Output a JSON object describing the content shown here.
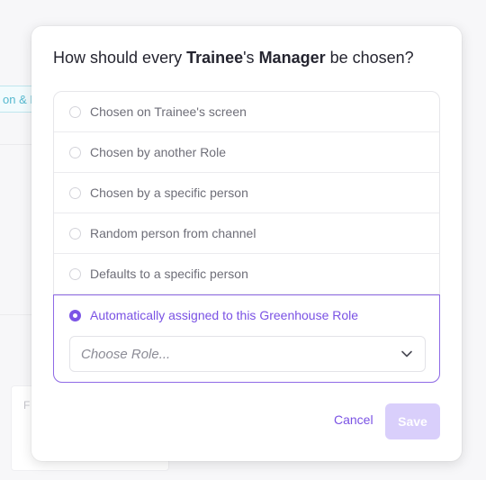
{
  "background": {
    "tag_text": "on & H",
    "card_letter": "F"
  },
  "dialog": {
    "title": {
      "prefix": "How should every ",
      "role_a": "Trainee",
      "middle": "'s ",
      "role_b": "Manager",
      "suffix": " be chosen?"
    },
    "options": [
      {
        "label": "Chosen on Trainee's screen",
        "selected": false
      },
      {
        "label": "Chosen by another Role",
        "selected": false
      },
      {
        "label": "Chosen by a specific person",
        "selected": false
      },
      {
        "label": "Random person from channel",
        "selected": false
      },
      {
        "label": "Defaults to a specific person",
        "selected": false
      },
      {
        "label": "Automatically assigned to this Greenhouse Role",
        "selected": true
      }
    ],
    "role_select": {
      "placeholder": "Choose Role..."
    },
    "cancel_label": "Cancel",
    "save_label": "Save"
  },
  "colors": {
    "accent": "#7a52e4",
    "save_disabled": "#d9cffb",
    "tag": "#56b9cf"
  },
  "icons": {
    "select_chevron": "chevron-down-icon"
  }
}
